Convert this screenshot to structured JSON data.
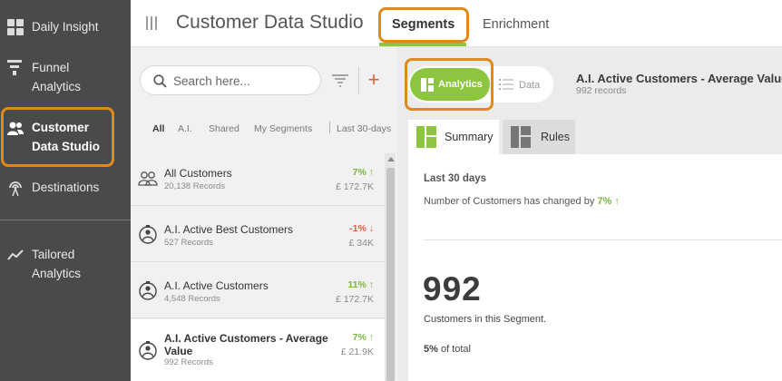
{
  "sidebar": {
    "items": [
      {
        "label_line1": "Daily Insight",
        "label_line2": "",
        "icon": "grid-icon"
      },
      {
        "label_line1": "Funnel",
        "label_line2": "Analytics",
        "icon": "funnel-icon"
      },
      {
        "label_line1": "Customer",
        "label_line2": "Data Studio",
        "icon": "users-icon"
      },
      {
        "label_line1": "Destinations",
        "label_line2": "",
        "icon": "broadcast-icon"
      },
      {
        "label_line1": "Tailored",
        "label_line2": "Analytics",
        "icon": "trend-icon"
      }
    ]
  },
  "header": {
    "title": "Customer Data Studio",
    "tabs": [
      "Segments",
      "Enrichment"
    ]
  },
  "list": {
    "search_placeholder": "Search here...",
    "add_symbol": "+",
    "filters": [
      "All",
      "A.I.",
      "Shared",
      "My Segments",
      "Last 30-days"
    ],
    "segments": [
      {
        "name": "All Customers",
        "records": "20,138 Records",
        "change": "7%",
        "arrow": "↑",
        "direction": "up",
        "amount": "£ 172.7K"
      },
      {
        "name": "A.I. Active Best Customers",
        "records": "527 Records",
        "change": "-1%",
        "arrow": "↓",
        "direction": "down",
        "amount": "£ 34K"
      },
      {
        "name": "A.I. Active Customers",
        "records": "4,548 Records",
        "change": "11%",
        "arrow": "↑",
        "direction": "up",
        "amount": "£ 172.7K"
      },
      {
        "name": "A.I. Active Customers - Average Value",
        "records": "992 Records",
        "change": "7%",
        "arrow": "↑",
        "direction": "up",
        "amount": "£ 21.9K"
      }
    ]
  },
  "detail": {
    "toggle_analytics": "Analytics",
    "toggle_data": "Data",
    "segment_title": "A.I. Active Customers - Average Value",
    "segment_records": "992 records",
    "tabs": [
      "Summary",
      "Rules"
    ],
    "period": "Last 30 days",
    "change_text": "Number of Customers has changed by",
    "change_value": "7%",
    "change_arrow": "↑",
    "count": "992",
    "count_caption": "Customers in this Segment.",
    "share_value": "5%",
    "share_suffix": "of total"
  },
  "colors": {
    "accent_green": "#8cc63f",
    "highlight_orange": "#e08a1e",
    "up_green": "#7ab63d",
    "down_red": "#e25b3b",
    "sidebar_bg": "#4a4a4a"
  }
}
